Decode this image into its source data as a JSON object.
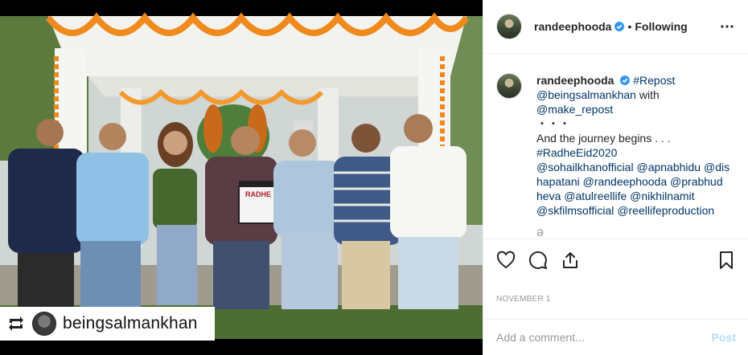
{
  "photo": {
    "description_icon": "repost-icon",
    "repost_badge": {
      "username": "beingsalmankhan"
    },
    "clapboard_text": "RADHE"
  },
  "post": {
    "author": "randeephooda",
    "separator": "•",
    "follow_state": "Following",
    "more_icon": "more-horizontal-icon"
  },
  "caption": {
    "author": "randeephooda",
    "lines": [
      {
        "parts": [
          {
            "t": "#Repost",
            "kind": "tag"
          }
        ]
      },
      {
        "parts": [
          {
            "t": "@beingsalmankhan",
            "kind": "tag"
          },
          {
            "t": " with",
            "kind": "plain"
          }
        ]
      },
      {
        "parts": [
          {
            "t": "@make_repost",
            "kind": "tag"
          }
        ]
      },
      {
        "parts": [
          {
            "t": "・・・",
            "kind": "plain"
          }
        ]
      },
      {
        "parts": [
          {
            "t": "And the journey begins . . .",
            "kind": "plain"
          }
        ]
      },
      {
        "parts": [
          {
            "t": "#RadheEid2020",
            "kind": "tag"
          }
        ]
      },
      {
        "parts": [
          {
            "t": "@sohailkhanofficial",
            "kind": "tag"
          },
          {
            "t": " ",
            "kind": "plain"
          },
          {
            "t": "@apnabhidu",
            "kind": "tag"
          },
          {
            "t": " ",
            "kind": "plain"
          },
          {
            "t": "@dis",
            "kind": "tag"
          }
        ]
      },
      {
        "parts": [
          {
            "t": "hapatani",
            "kind": "tag"
          },
          {
            "t": " ",
            "kind": "plain"
          },
          {
            "t": "@randeephooda",
            "kind": "tag"
          },
          {
            "t": " ",
            "kind": "plain"
          },
          {
            "t": "@prabhud",
            "kind": "tag"
          }
        ]
      },
      {
        "parts": [
          {
            "t": "heva",
            "kind": "tag"
          },
          {
            "t": " ",
            "kind": "plain"
          },
          {
            "t": "@atulreellife",
            "kind": "tag"
          },
          {
            "t": " ",
            "kind": "plain"
          },
          {
            "t": "@nikhilnamit",
            "kind": "tag"
          }
        ]
      },
      {
        "parts": [
          {
            "t": "@skfilmsofficial",
            "kind": "tag"
          },
          {
            "t": " ",
            "kind": "plain"
          },
          {
            "t": "@reellifeproduction",
            "kind": "tag"
          }
        ]
      }
    ],
    "tail": "ə"
  },
  "actions": {
    "like_icon": "heart-icon",
    "comment_icon": "comment-icon",
    "share_icon": "share-icon",
    "save_icon": "bookmark-icon"
  },
  "date": "NOVEMBER 1",
  "comment": {
    "placeholder": "Add a comment...",
    "post_label": "Post"
  },
  "colors": {
    "link": "#003569",
    "verified": "#3897f0",
    "post_disabled": "#b2dffc",
    "meta": "#999999"
  }
}
